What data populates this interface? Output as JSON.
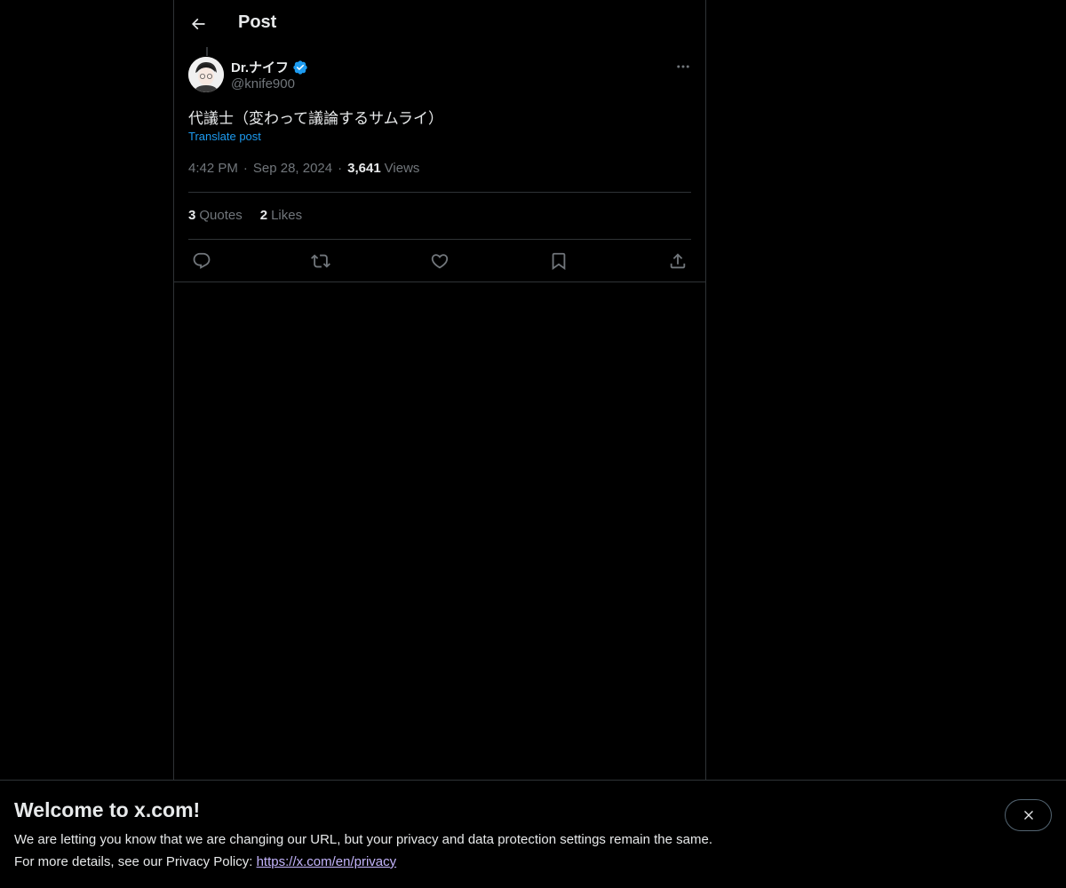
{
  "header": {
    "title": "Post"
  },
  "post": {
    "author_name": "Dr.ナイフ",
    "author_handle": "@knife900",
    "text": "代議士（変わって議論するサムライ）",
    "translate_label": "Translate post",
    "time": "4:42 PM",
    "date": "Sep 28, 2024",
    "separator": "·",
    "views_count": "3,641",
    "views_label": "Views",
    "quotes_count": "3",
    "quotes_label": "Quotes",
    "likes_count": "2",
    "likes_label": "Likes"
  },
  "icons": {
    "back": "arrow-left-icon",
    "verified": "verified-badge-icon",
    "more": "more-horizontal-icon",
    "reply": "reply-icon",
    "repost": "repost-icon",
    "like": "heart-icon",
    "bookmark": "bookmark-icon",
    "share": "share-icon",
    "close": "close-icon"
  },
  "banner": {
    "title": "Welcome to x.com!",
    "line1": "We are letting you know that we are changing our URL, but your privacy and data protection settings remain the same.",
    "line2_prefix": "For more details, see our Privacy Policy: ",
    "link_text": "https://x.com/en/privacy"
  },
  "colors": {
    "background": "#000000",
    "text_primary": "#e7e9ea",
    "text_secondary": "#71767b",
    "accent": "#1d9bf0",
    "border": "#2f3336",
    "link_visited": "#c4b5fd"
  }
}
